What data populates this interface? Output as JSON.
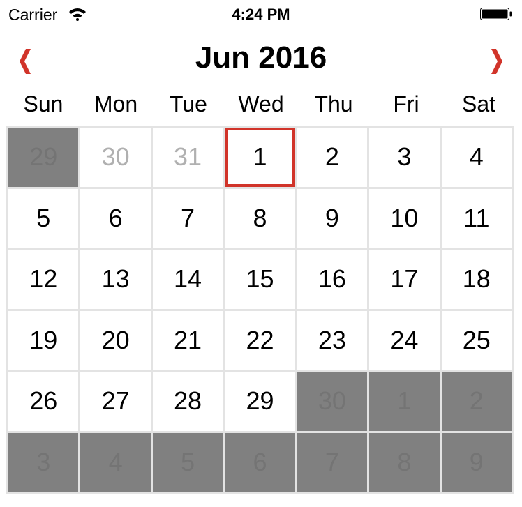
{
  "status_bar": {
    "carrier": "Carrier",
    "time": "4:24 PM"
  },
  "header": {
    "title": "Jun 2016",
    "prev_icon": "chevron-left-icon",
    "next_icon": "chevron-right-icon",
    "accent_color": "#d1342a"
  },
  "weekdays": [
    "Sun",
    "Mon",
    "Tue",
    "Wed",
    "Thu",
    "Fri",
    "Sat"
  ],
  "days": [
    {
      "label": "29",
      "state": "dim"
    },
    {
      "label": "30",
      "state": "muted"
    },
    {
      "label": "31",
      "state": "muted"
    },
    {
      "label": "1",
      "state": "selected"
    },
    {
      "label": "2",
      "state": "normal"
    },
    {
      "label": "3",
      "state": "normal"
    },
    {
      "label": "4",
      "state": "normal"
    },
    {
      "label": "5",
      "state": "normal"
    },
    {
      "label": "6",
      "state": "normal"
    },
    {
      "label": "7",
      "state": "normal"
    },
    {
      "label": "8",
      "state": "normal"
    },
    {
      "label": "9",
      "state": "normal"
    },
    {
      "label": "10",
      "state": "normal"
    },
    {
      "label": "11",
      "state": "normal"
    },
    {
      "label": "12",
      "state": "normal"
    },
    {
      "label": "13",
      "state": "normal"
    },
    {
      "label": "14",
      "state": "normal"
    },
    {
      "label": "15",
      "state": "normal"
    },
    {
      "label": "16",
      "state": "normal"
    },
    {
      "label": "17",
      "state": "normal"
    },
    {
      "label": "18",
      "state": "normal"
    },
    {
      "label": "19",
      "state": "normal"
    },
    {
      "label": "20",
      "state": "normal"
    },
    {
      "label": "21",
      "state": "normal"
    },
    {
      "label": "22",
      "state": "normal"
    },
    {
      "label": "23",
      "state": "normal"
    },
    {
      "label": "24",
      "state": "normal"
    },
    {
      "label": "25",
      "state": "normal"
    },
    {
      "label": "26",
      "state": "normal"
    },
    {
      "label": "27",
      "state": "normal"
    },
    {
      "label": "28",
      "state": "normal"
    },
    {
      "label": "29",
      "state": "normal"
    },
    {
      "label": "30",
      "state": "dim"
    },
    {
      "label": "1",
      "state": "dim"
    },
    {
      "label": "2",
      "state": "dim"
    },
    {
      "label": "3",
      "state": "dim"
    },
    {
      "label": "4",
      "state": "dim"
    },
    {
      "label": "5",
      "state": "dim"
    },
    {
      "label": "6",
      "state": "dim"
    },
    {
      "label": "7",
      "state": "dim"
    },
    {
      "label": "8",
      "state": "dim"
    },
    {
      "label": "9",
      "state": "dim"
    }
  ]
}
